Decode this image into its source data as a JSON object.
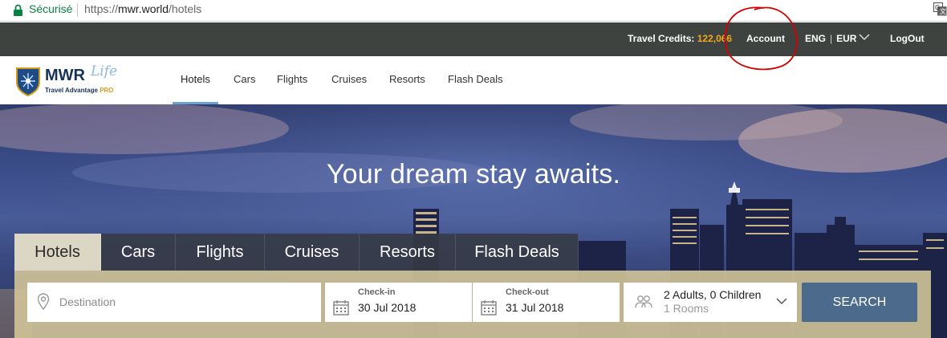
{
  "browser": {
    "secure_label": "Sécurisé",
    "url_scheme": "https://",
    "url_host": "mwr.world",
    "url_path": "/hotels"
  },
  "topbar": {
    "credits_label": "Travel Credits:",
    "credits_value": "122,066",
    "account": "Account",
    "lang": "ENG",
    "currency": "EUR",
    "logout": "LogOut"
  },
  "brand": {
    "name": "MWR",
    "script": "Life",
    "tagline": "Travel Advantage",
    "tier": "PRO"
  },
  "nav": {
    "items": [
      {
        "label": "Hotels",
        "active": true
      },
      {
        "label": "Cars"
      },
      {
        "label": "Flights"
      },
      {
        "label": "Cruises"
      },
      {
        "label": "Resorts"
      },
      {
        "label": "Flash Deals"
      }
    ]
  },
  "hero": {
    "headline": "Your dream stay awaits."
  },
  "search": {
    "tabs": [
      {
        "label": "Hotels",
        "active": true
      },
      {
        "label": "Cars"
      },
      {
        "label": "Flights"
      },
      {
        "label": "Cruises"
      },
      {
        "label": "Resorts"
      },
      {
        "label": "Flash Deals"
      }
    ],
    "destination_placeholder": "Destination",
    "checkin_label": "Check-in",
    "checkin_value": "30 Jul 2018",
    "checkout_label": "Check-out",
    "checkout_value": "31 Jul 2018",
    "guests": "2 Adults,  0 Children",
    "rooms": "1 Rooms",
    "button": "SEARCH"
  },
  "colors": {
    "topbar": "#3f433f",
    "credits_value": "#f1a81a",
    "annotation": "#d40000",
    "search_button": "#4c6a8c"
  }
}
